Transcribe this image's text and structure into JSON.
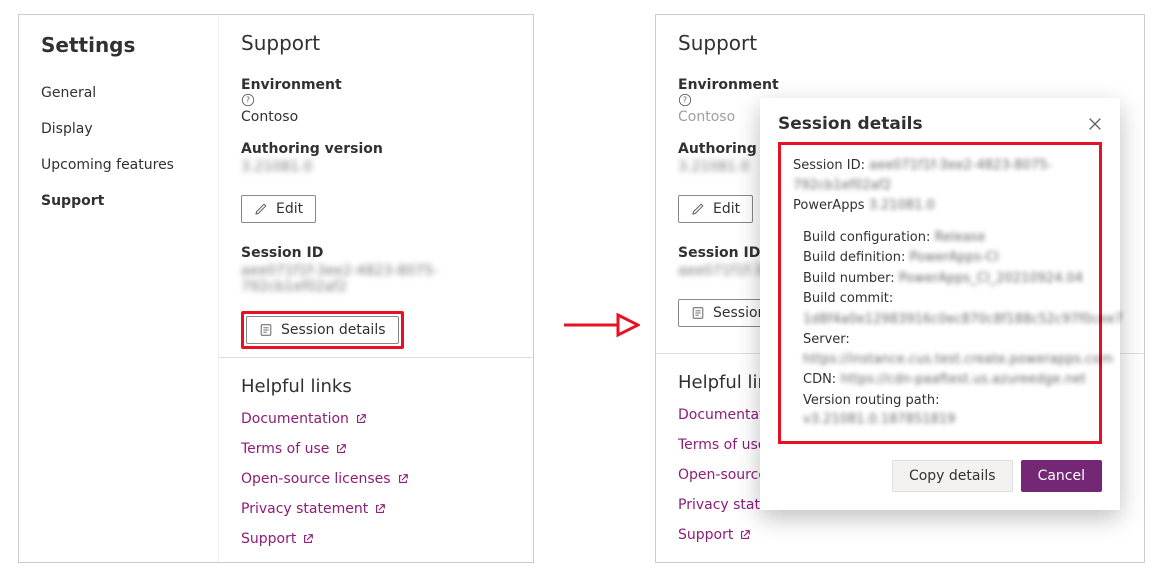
{
  "sidebar": {
    "title": "Settings",
    "items": [
      {
        "label": "General"
      },
      {
        "label": "Display"
      },
      {
        "label": "Upcoming features"
      },
      {
        "label": "Support"
      }
    ]
  },
  "support": {
    "title": "Support",
    "env_label": "Environment",
    "env_value": "Contoso",
    "authoring_label": "Authoring version",
    "authoring_value": "3.21081.0",
    "edit_btn": "Edit",
    "session_label": "Session ID",
    "session_value": "aee071f1f-3ee2-4823-8075-792cb1ef02af2",
    "session_details_btn": "Session details",
    "helpful_links_title": "Helpful links",
    "links": {
      "docs": "Documentation",
      "terms": "Terms of use",
      "oss": "Open-source licenses",
      "privacy": "Privacy statement",
      "support": "Support"
    }
  },
  "modal": {
    "title": "Session details",
    "session_id_label": "Session ID:",
    "session_id_value": "aee071f1f-3ee2-4823-8075-792cb1ef02af2",
    "powerapps_label": "PowerApps",
    "powerapps_value": "3.21081.0",
    "build_config_label": "Build configuration:",
    "build_config_value": "Release",
    "build_def_label": "Build definition:",
    "build_def_value": "PowerApps-CI",
    "build_num_label": "Build number:",
    "build_num_value": "PowerApps_CI_20210924.04",
    "build_commit_label": "Build commit:",
    "build_commit_value": "1d8f4a0e12983916c0ec870c8f188c52c97f0cee7",
    "server_label": "Server:",
    "server_value": "https://instance.cus.test.create.powerapps.com",
    "cdn_label": "CDN:",
    "cdn_value": "https://cdn-paaftest.us.azureedge.net",
    "routing_label": "Version routing path:",
    "routing_value": "v3.21081.0.187851819",
    "copy_btn": "Copy details",
    "cancel_btn": "Cancel"
  }
}
